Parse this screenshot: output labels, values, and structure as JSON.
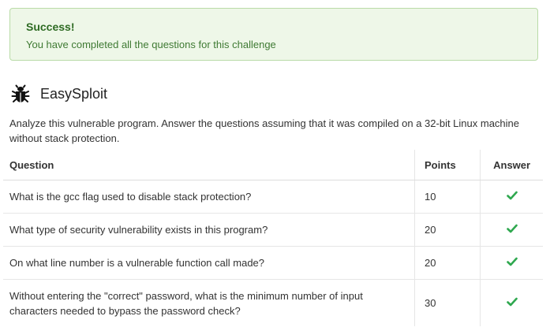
{
  "alert": {
    "title": "Success!",
    "message": "You have completed all the questions for this challenge",
    "color": "#2e6b23"
  },
  "challenge": {
    "icon": "bug-icon",
    "title": "EasySploit",
    "description": "Analyze this vulnerable program. Answer the questions assuming that it was compiled on a 32-bit Linux machine without stack protection."
  },
  "table": {
    "headers": {
      "question": "Question",
      "points": "Points",
      "answer": "Answer"
    },
    "rows": [
      {
        "question": "What is the gcc flag used to disable stack protection?",
        "points": "10",
        "answer": "check-icon"
      },
      {
        "question": "What type of security vulnerability exists in this program?",
        "points": "20",
        "answer": "check-icon"
      },
      {
        "question": "On what line number is a vulnerable function call made?",
        "points": "20",
        "answer": "check-icon"
      },
      {
        "question": "Without entering the \"correct\" password, what is the minimum number of input characters needed to bypass the password check?",
        "points": "30",
        "answer": "check-icon"
      }
    ],
    "check_color": "#2fa84f"
  }
}
